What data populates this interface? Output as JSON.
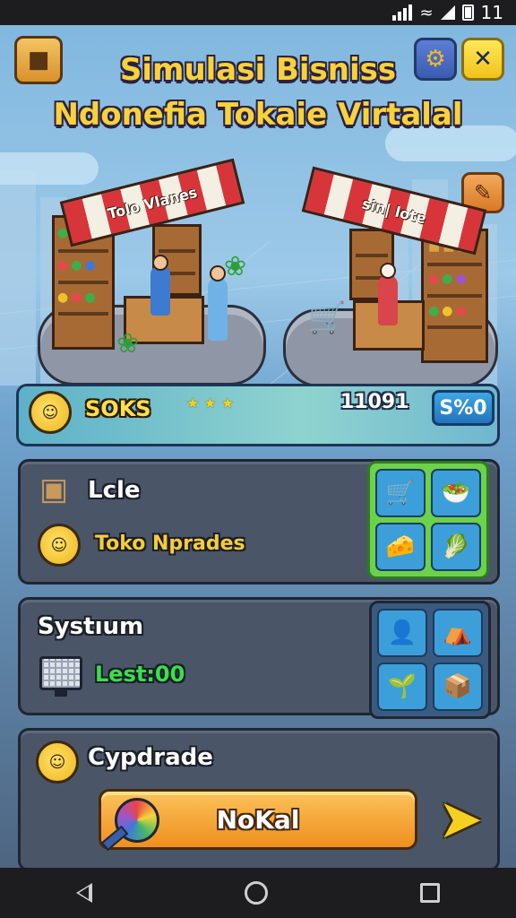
{
  "status_bar": {
    "time": "11"
  },
  "header": {
    "title_line1": "Simulasi Bisniss",
    "title_line2": "Ndonefia Tokaie Virtalal"
  },
  "stalls": [
    {
      "sign": "Tolo Vlanes"
    },
    {
      "sign": "sin| lotɐ"
    }
  ],
  "status_strip": {
    "label": "SOKS",
    "stars": "★ ★ ★",
    "count": "11091",
    "badge": "S%0"
  },
  "card_shop": {
    "title": "Lcle",
    "subtitle": "Toko Nprades",
    "tiles": [
      "shopping-cart",
      "vegetable-crate",
      "fruit-and-cheese",
      "lettuce-basket"
    ]
  },
  "card_system": {
    "title": "Systıum",
    "stat": "Lest:00",
    "tiles": [
      "shopkeeper",
      "market-stall",
      "potted-plant",
      "cardboard-boxes"
    ]
  },
  "card_upgrade": {
    "title": "Cypdrade",
    "button": "NoKal"
  },
  "colors": {
    "accent_yellow": "#f7d23a",
    "accent_green": "#39e04a",
    "card_bg": "#4a5567",
    "button_orange": "#ef8f1e",
    "badge_blue": "#2275bd"
  }
}
